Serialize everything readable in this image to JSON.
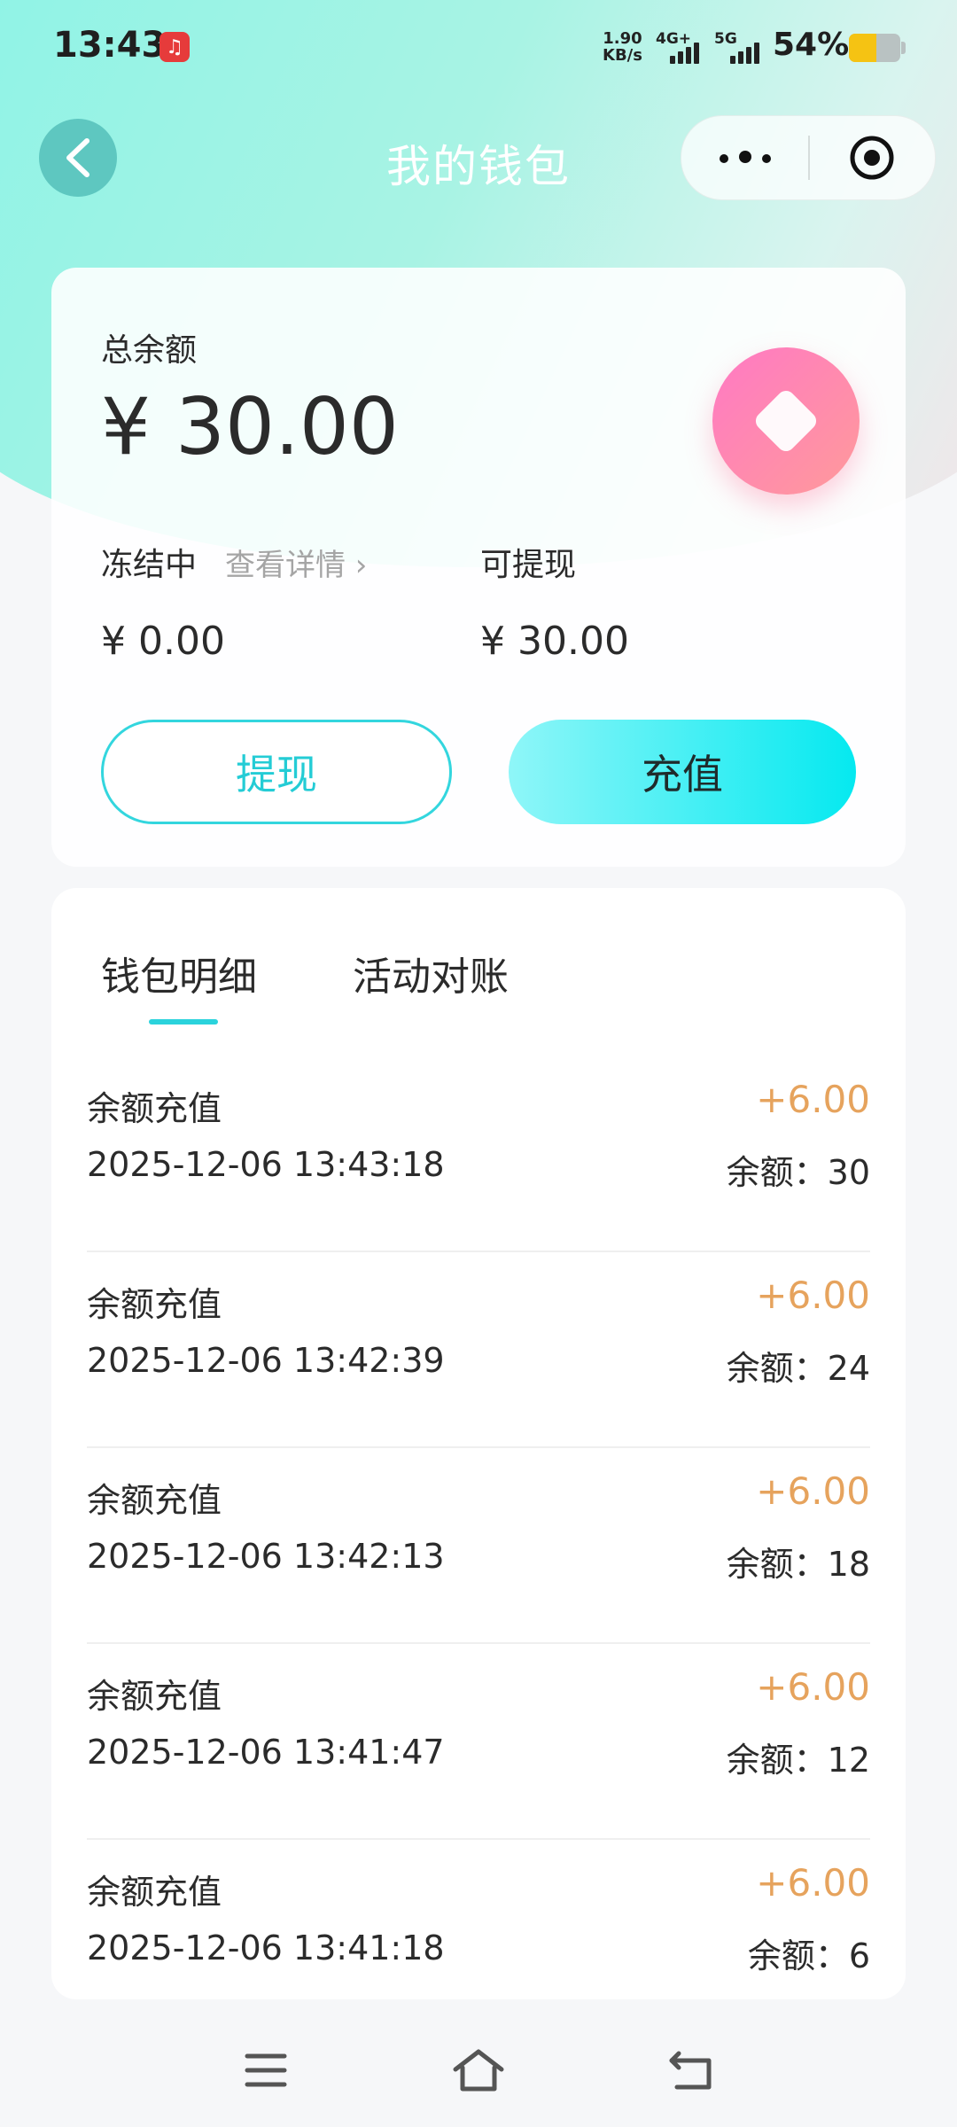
{
  "status_bar": {
    "time": "13:43",
    "app_icon_glyph": "♫",
    "speed_value": "1.90",
    "speed_unit": "KB/s",
    "net1": "4G+",
    "net2": "5G",
    "battery_text": "54%",
    "battery_level": 0.54,
    "battery_color": "#f5c313"
  },
  "nav": {
    "title": "我的钱包"
  },
  "balance": {
    "total_label": "总余额",
    "total_amount": "¥ 30.00",
    "frozen_label": "冻结中",
    "frozen_link": "查看详情 ›",
    "frozen_amount": "¥ 0.00",
    "withdrawable_label": "可提现",
    "withdrawable_amount": "¥ 30.00",
    "withdraw_button": "提现",
    "recharge_button": "充值"
  },
  "tabs": [
    {
      "label": "钱包明细",
      "active": true
    },
    {
      "label": "活动对账",
      "active": false
    }
  ],
  "records": [
    {
      "title": "余额充值",
      "time": "2025-12-06 13:43:18",
      "amount": "+6.00",
      "balance": "余额：30"
    },
    {
      "title": "余额充值",
      "time": "2025-12-06 13:42:39",
      "amount": "+6.00",
      "balance": "余额：24"
    },
    {
      "title": "余额充值",
      "time": "2025-12-06 13:42:13",
      "amount": "+6.00",
      "balance": "余额：18"
    },
    {
      "title": "余额充值",
      "time": "2025-12-06 13:41:47",
      "amount": "+6.00",
      "balance": "余额：12"
    },
    {
      "title": "余额充值",
      "time": "2025-12-06 13:41:18",
      "amount": "+6.00",
      "balance": "余额：6"
    }
  ],
  "colors": {
    "accent": "#24ccd5",
    "amount_positive": "#e6a35d"
  },
  "icons": {
    "back": "chevron-left-icon",
    "more": "more-dots-icon",
    "target": "target-icon",
    "badge": "diamond-icon",
    "menu": "menu-icon",
    "home": "home-icon",
    "nav_back": "back-arrow-icon"
  }
}
